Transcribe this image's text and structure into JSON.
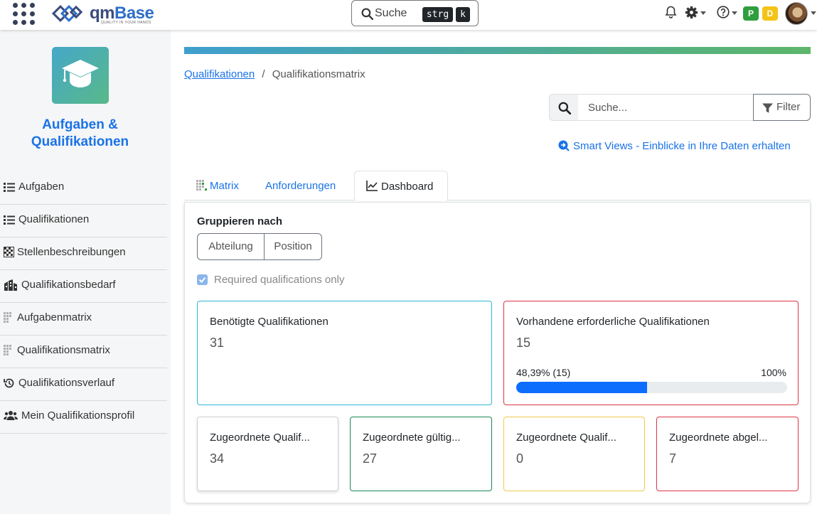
{
  "topbar": {
    "logo_text_1": "qm",
    "logo_text_2": "Base",
    "logo_tagline": "QUALITY IN YOUR HANDS",
    "search_label": "Suche",
    "shortcut_1": "strg",
    "shortcut_2": "k",
    "badge_p": "P",
    "badge_d": "D",
    "badge_p_color": "#2e9e3e",
    "badge_d_color": "#f3c316"
  },
  "sidebar": {
    "module_title": "Aufgaben & Qualifikationen",
    "items": [
      {
        "label": "Aufgaben",
        "icon": "list-icon"
      },
      {
        "label": "Qualifikationen",
        "icon": "list-icon"
      },
      {
        "label": "Stellenbeschreibungen",
        "icon": "grid-icon"
      },
      {
        "label": "Qualifikationsbedarf",
        "icon": "building-icon"
      },
      {
        "label": "Aufgabenmatrix",
        "icon": "matrix-icon"
      },
      {
        "label": "Qualifikationsmatrix",
        "icon": "matrix-icon"
      },
      {
        "label": "Qualifikationsverlauf",
        "icon": "history-icon"
      },
      {
        "label": "Mein Qualifikationsprofil",
        "icon": "users-icon"
      }
    ]
  },
  "breadcrumb": {
    "parent": "Qualifikationen",
    "separator": "/",
    "current": "Qualifikationsmatrix"
  },
  "search": {
    "placeholder": "Suche...",
    "filter_label": "Filter"
  },
  "smart_views_link": "Smart Views - Einblicke in Ihre Daten erhalten",
  "tabs": [
    {
      "label": "Matrix",
      "active": false
    },
    {
      "label": "Anforderungen",
      "active": false
    },
    {
      "label": "Dashboard",
      "active": true
    }
  ],
  "dashboard": {
    "group_by_label": "Gruppieren nach",
    "group_options": [
      "Abteilung",
      "Position"
    ],
    "required_only_label": "Required qualifications only",
    "required_only_checked": true,
    "cards": {
      "needed": {
        "title": "Benötigte Qualifikationen",
        "value": "31",
        "color": "#31b6d6"
      },
      "present": {
        "title": "Vorhandene erforderliche Qualifikationen",
        "value": "15",
        "color": "#dc3545",
        "progress_label": "48,39% (15)",
        "progress_max": "100%",
        "progress": 0.4839
      }
    },
    "small_cards": [
      {
        "title": "Zugeordnete Qualif...",
        "value": "34",
        "color": "#cfcfcf"
      },
      {
        "title": "Zugeordnete gültig...",
        "value": "27",
        "color": "#198754"
      },
      {
        "title": "Zugeordnete Qualif...",
        "value": "0",
        "color": "#f2c94c"
      },
      {
        "title": "Zugeordnete abgel...",
        "value": "7",
        "color": "#dc3545"
      }
    ]
  }
}
